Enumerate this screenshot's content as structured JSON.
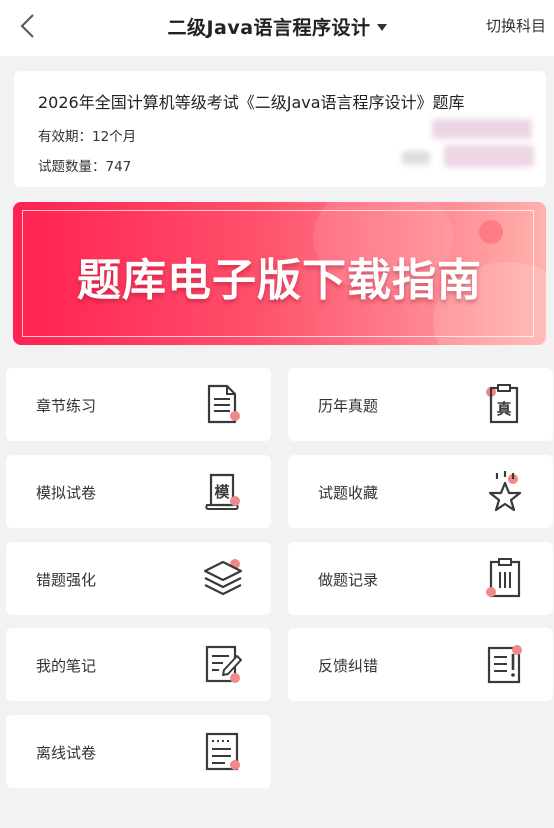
{
  "header": {
    "title": "二级Java语言程序设计",
    "switch_label": "切换科目"
  },
  "info": {
    "title": "2026年全国计算机等级考试《二级Java语言程序设计》题库",
    "validity": "有效期：12个月",
    "question_count": "试题数量：747"
  },
  "banner": {
    "text": "题库电子版下载指南"
  },
  "menu": [
    {
      "label": "章节练习",
      "icon": "document-icon"
    },
    {
      "label": "历年真题",
      "icon": "clipboard-zhen-icon"
    },
    {
      "label": "模拟试卷",
      "icon": "scroll-mo-icon"
    },
    {
      "label": "试题收藏",
      "icon": "star-icon"
    },
    {
      "label": "错题强化",
      "icon": "layers-icon"
    },
    {
      "label": "做题记录",
      "icon": "clipboard-list-icon"
    },
    {
      "label": "我的笔记",
      "icon": "note-pencil-icon"
    },
    {
      "label": "反馈纠错",
      "icon": "feedback-icon"
    },
    {
      "label": "离线试卷",
      "icon": "offline-paper-icon"
    }
  ],
  "colors": {
    "accent": "#ff2150",
    "icon_dot": "#f08a8a",
    "icon_stroke": "#3a3a3a"
  }
}
